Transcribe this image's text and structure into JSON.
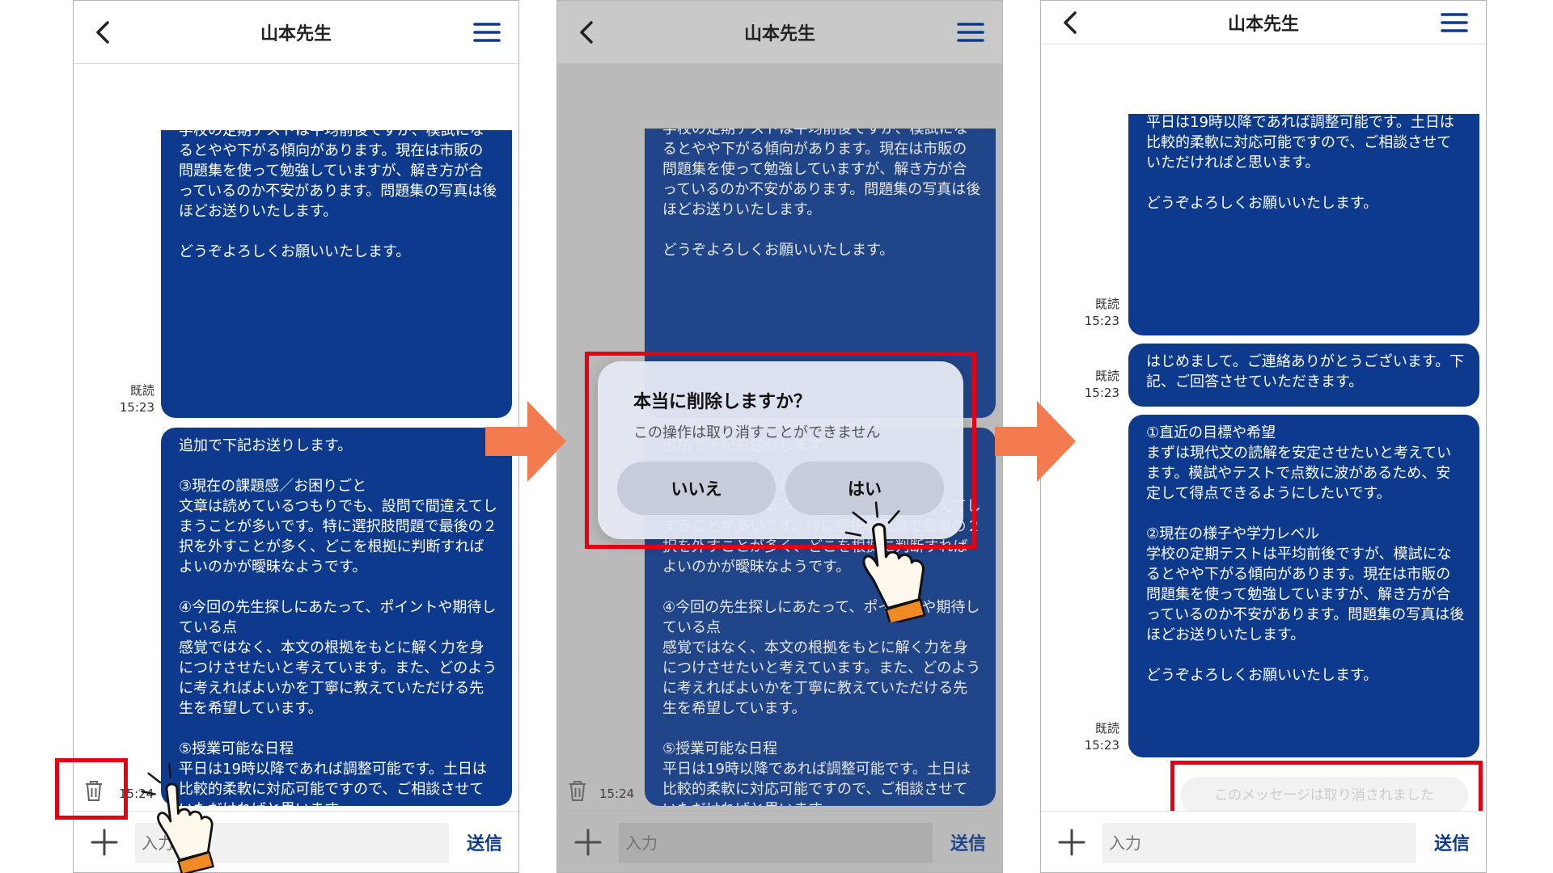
{
  "colors": {
    "bubble": "#0d3a8c",
    "accent": "#0d3a8c",
    "highlight": "#e60012",
    "arrow": "#f47a50",
    "hand_cuff": "#f08a24"
  },
  "header": {
    "title": "山本先生"
  },
  "composer": {
    "placeholder": "入力",
    "send_label": "送信"
  },
  "meta": {
    "read_label": "既読",
    "time_1523": "15:23",
    "time_1524": "15:24"
  },
  "messages": {
    "msg1": "①直近の目標や希望\nまずは現代文の読解を安定させたいと考えています。模試やテストで点数に波があるため、安定して得点できるようにしたいです。\n\n②現在の様子や学力レベル\n学校の定期テストは平均前後ですが、模試になるとやや下がる傾向があります。現在は市販の問題集を使って勉強していますが、解き方が合っているのか不安があります。問題集の写真は後ほどお送りいたします。\n\nどうぞよろしくお願いいたします。",
    "msg2": "追加で下記お送りします。\n\n③現在の課題感／お困りごと\n文章は読めているつもりでも、設問で間違えてしまうことが多いです。特に選択肢問題で最後の２択を外すことが多く、どこを根拠に判断すればよいのかが曖昧なようです。\n\n④今回の先生探しにあたって、ポイントや期待している点\n感覚ではなく、本文の根拠をもとに解く力を身につけさせたいと考えています。また、どのように考えればよいかを丁寧に教えていただける先生を希望しています。\n\n⑤授業可能な日程\n平日は19時以降であれば調整可能です。土日は比較的柔軟に対応可能ですので、ご相談させていただければと思います。\n\nどうぞよろしくお願いいたします。",
    "msg_greeting": "はじめまして。ご連絡ありがとうございます。下記、ご回答させていただきます。"
  },
  "dialog": {
    "title": "本当に削除しますか？",
    "description": "この操作は取り消すことができません",
    "no_label": "いいえ",
    "yes_label": "はい"
  },
  "deleted_notice": "このメッセージは取り消されました"
}
